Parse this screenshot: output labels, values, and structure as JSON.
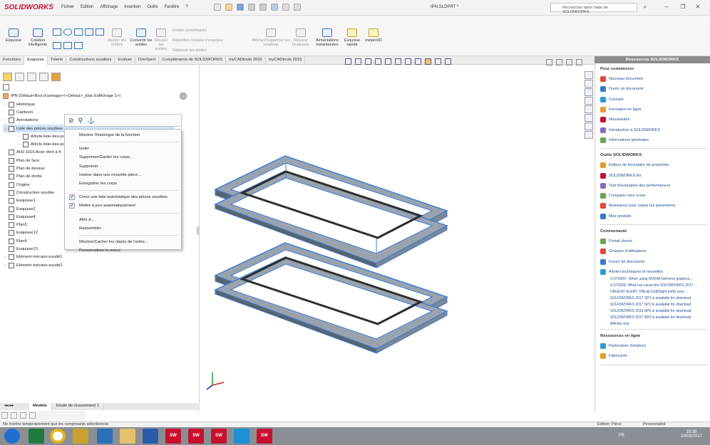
{
  "app": {
    "logo": "SOLIDWORKS",
    "menus": [
      "Fichier",
      "Edition",
      "Affichage",
      "Insertion",
      "Outils",
      "Fenêtre",
      "?"
    ],
    "document_title": "IPN.SLDPRT *",
    "help_search_placeholder": "Rechercher dans l'aide de SOLIDWORKS"
  },
  "ribbon": {
    "tools": [
      {
        "label": "Esquisse",
        "enabled": true
      },
      {
        "label": "Cotation intelligente",
        "enabled": true
      },
      {
        "label": "Ajuster les entités",
        "enabled": false
      },
      {
        "label": "Convertir les entités",
        "enabled": true
      },
      {
        "label": "Décaler les entités",
        "enabled": false
      },
      {
        "label": "Entités symétriques",
        "enabled": false
      },
      {
        "label": "Répétition linéaire d'esquisse",
        "enabled": false
      },
      {
        "label": "Déplacer les entités",
        "enabled": false
      },
      {
        "label": "Afficher/Supprimer les relations",
        "enabled": false
      },
      {
        "label": "Réparer l'esquisse",
        "enabled": false
      },
      {
        "label": "Aimantations instantanées",
        "enabled": true
      },
      {
        "label": "Esquisse rapide",
        "enabled": true
      },
      {
        "label": "Instant2D",
        "enabled": true
      }
    ]
  },
  "tabs": [
    "Fonctions",
    "Esquisse",
    "Tôlerie",
    "Constructions soudées",
    "Evaluer",
    "DimXpert",
    "Compléments de SOLIDWORKS",
    "myCADtools 2016",
    "myCADtools 2015"
  ],
  "tree": {
    "root": "IPN  (Défaut<Brut d'usinage><<Défaut>_Etat d'affichage 1>)",
    "items": [
      {
        "label": "Historique",
        "expand": "›",
        "selected": false,
        "indent": 1
      },
      {
        "label": "Capteurs",
        "expand": "",
        "selected": false,
        "indent": 1
      },
      {
        "label": "Annotations",
        "expand": "›",
        "selected": false,
        "indent": 1
      },
      {
        "label": "Liste des pièces soudées",
        "expand": "⌄",
        "selected": true,
        "indent": 1
      },
      {
        "label": "Article-liste-des-pi",
        "expand": "›",
        "selected": false,
        "indent": 2
      },
      {
        "label": "Article-liste-des-pi",
        "expand": "›",
        "selected": false,
        "indent": 2
      },
      {
        "label": "AISI 1015 Acier étiré à fr",
        "expand": "",
        "selected": false,
        "indent": 1
      },
      {
        "label": "Plan de face",
        "expand": "",
        "selected": false,
        "indent": 1
      },
      {
        "label": "Plan de dessus",
        "expand": "",
        "selected": false,
        "indent": 1
      },
      {
        "label": "Plan de droite",
        "expand": "",
        "selected": false,
        "indent": 1
      },
      {
        "label": "Origine",
        "expand": "",
        "selected": false,
        "indent": 1
      },
      {
        "label": "Construction soudée",
        "expand": "",
        "selected": false,
        "indent": 1
      },
      {
        "label": "Esquisse1",
        "expand": "",
        "selected": false,
        "indent": 1
      },
      {
        "label": "Esquisse2",
        "expand": "",
        "selected": false,
        "indent": 1
      },
      {
        "label": "Esquisse4",
        "expand": "",
        "selected": false,
        "indent": 1
      },
      {
        "label": "Plan5",
        "expand": "",
        "selected": false,
        "indent": 1
      },
      {
        "label": "Esquisse12",
        "expand": "",
        "selected": false,
        "indent": 1
      },
      {
        "label": "Plan6",
        "expand": "",
        "selected": false,
        "indent": 1
      },
      {
        "label": "Esquisse13",
        "expand": "",
        "selected": false,
        "indent": 1
      },
      {
        "label": "Elément mécano-soudé1",
        "expand": "›",
        "selected": false,
        "indent": 1
      },
      {
        "label": "Elément mécano-soudé2",
        "expand": "›",
        "selected": false,
        "indent": 1
      }
    ]
  },
  "context_menu": {
    "items": [
      {
        "label": "Montrer l'historique de la fonction",
        "check": false
      },
      {
        "label": "Isoler",
        "check": false
      },
      {
        "label": "Supprimer/Garder les corps...",
        "check": false
      },
      {
        "label": "Supprimer",
        "check": false
      },
      {
        "label": "Insérer dans une nouvelle pièce...",
        "check": false
      },
      {
        "label": "Enregistrer les corps",
        "check": false
      },
      {
        "label": "Créer une liste automatique des pièces soudées",
        "check": true
      },
      {
        "label": "Mettre à jour automatiquement",
        "check": true
      },
      {
        "label": "Aller à...",
        "check": false
      },
      {
        "label": "Rassembler",
        "check": false
      },
      {
        "label": "Montrer/Cacher les objets de l'arbre...",
        "check": false
      },
      {
        "label": "Personnaliser le menu",
        "check": false
      }
    ]
  },
  "bottom_tabs": [
    "Modèle",
    "Etude de mouvement 1"
  ],
  "task_pane": {
    "title": "Ressources SOLIDWORKS",
    "sections": [
      {
        "title": "Pour commencer",
        "links": [
          "Nouveau document",
          "Ouvrir un document",
          "Tutoriels",
          "Formation en ligne",
          "Nouveautés",
          "Introduction à SOLIDWORKS",
          "Informations générales"
        ]
      },
      {
        "title": "Outils SOLIDWORKS",
        "links": [
          "Editeur de formulaire de propriétés",
          "SOLIDWORKS Rx",
          "Test d'évaluation des performances",
          "Comparer mon score",
          "Assistance pour copier les paramètres",
          "Mes produits"
        ]
      },
      {
        "title": "Communauté",
        "links": [
          "Portail clients",
          "Groupes d'utilisateurs",
          "Forum de discussion",
          "Alertes techniques et nouvelles"
        ],
        "news": [
          "S-072800 - When using NVIDIA GeForce graphics...",
          "S-072608: What can cause the SOLIDWORKS 2017 ...",
          "URGENT ALERT: Official DraftSight hotfix avai...",
          "SOLIDWORKS 2017 SP2 is available for download",
          "SOLIDWORKS 2017 SP1 is available for download",
          "SOLIDWORKS 2016 SP5 is available for download",
          "SOLIDWORKS 2017 SP0 is available for download"
        ],
        "more": "Afficher tout"
      },
      {
        "title": "Ressources en ligne",
        "links": [
          "Partenaires Solutions",
          "Fabricants"
        ]
      }
    ]
  },
  "status": {
    "message": "Ne montre temporairement que les composants sélectionnés",
    "mode": "Edition: Pièce",
    "config": "Personnalisé"
  },
  "taskbar": {
    "apps": [
      "X",
      "Chrome",
      "O",
      "Explorer",
      "W",
      "SW 2015",
      "SW 2016",
      "SW 2017",
      "S",
      "SW 2016"
    ],
    "lang": "FR",
    "time": "15:35",
    "date": "10/03/2017"
  },
  "colors": {
    "accent": "#c8102e",
    "link": "#1f4e8c",
    "selection": "#cfe3f7",
    "frame_edge": "#3d7ed8"
  }
}
